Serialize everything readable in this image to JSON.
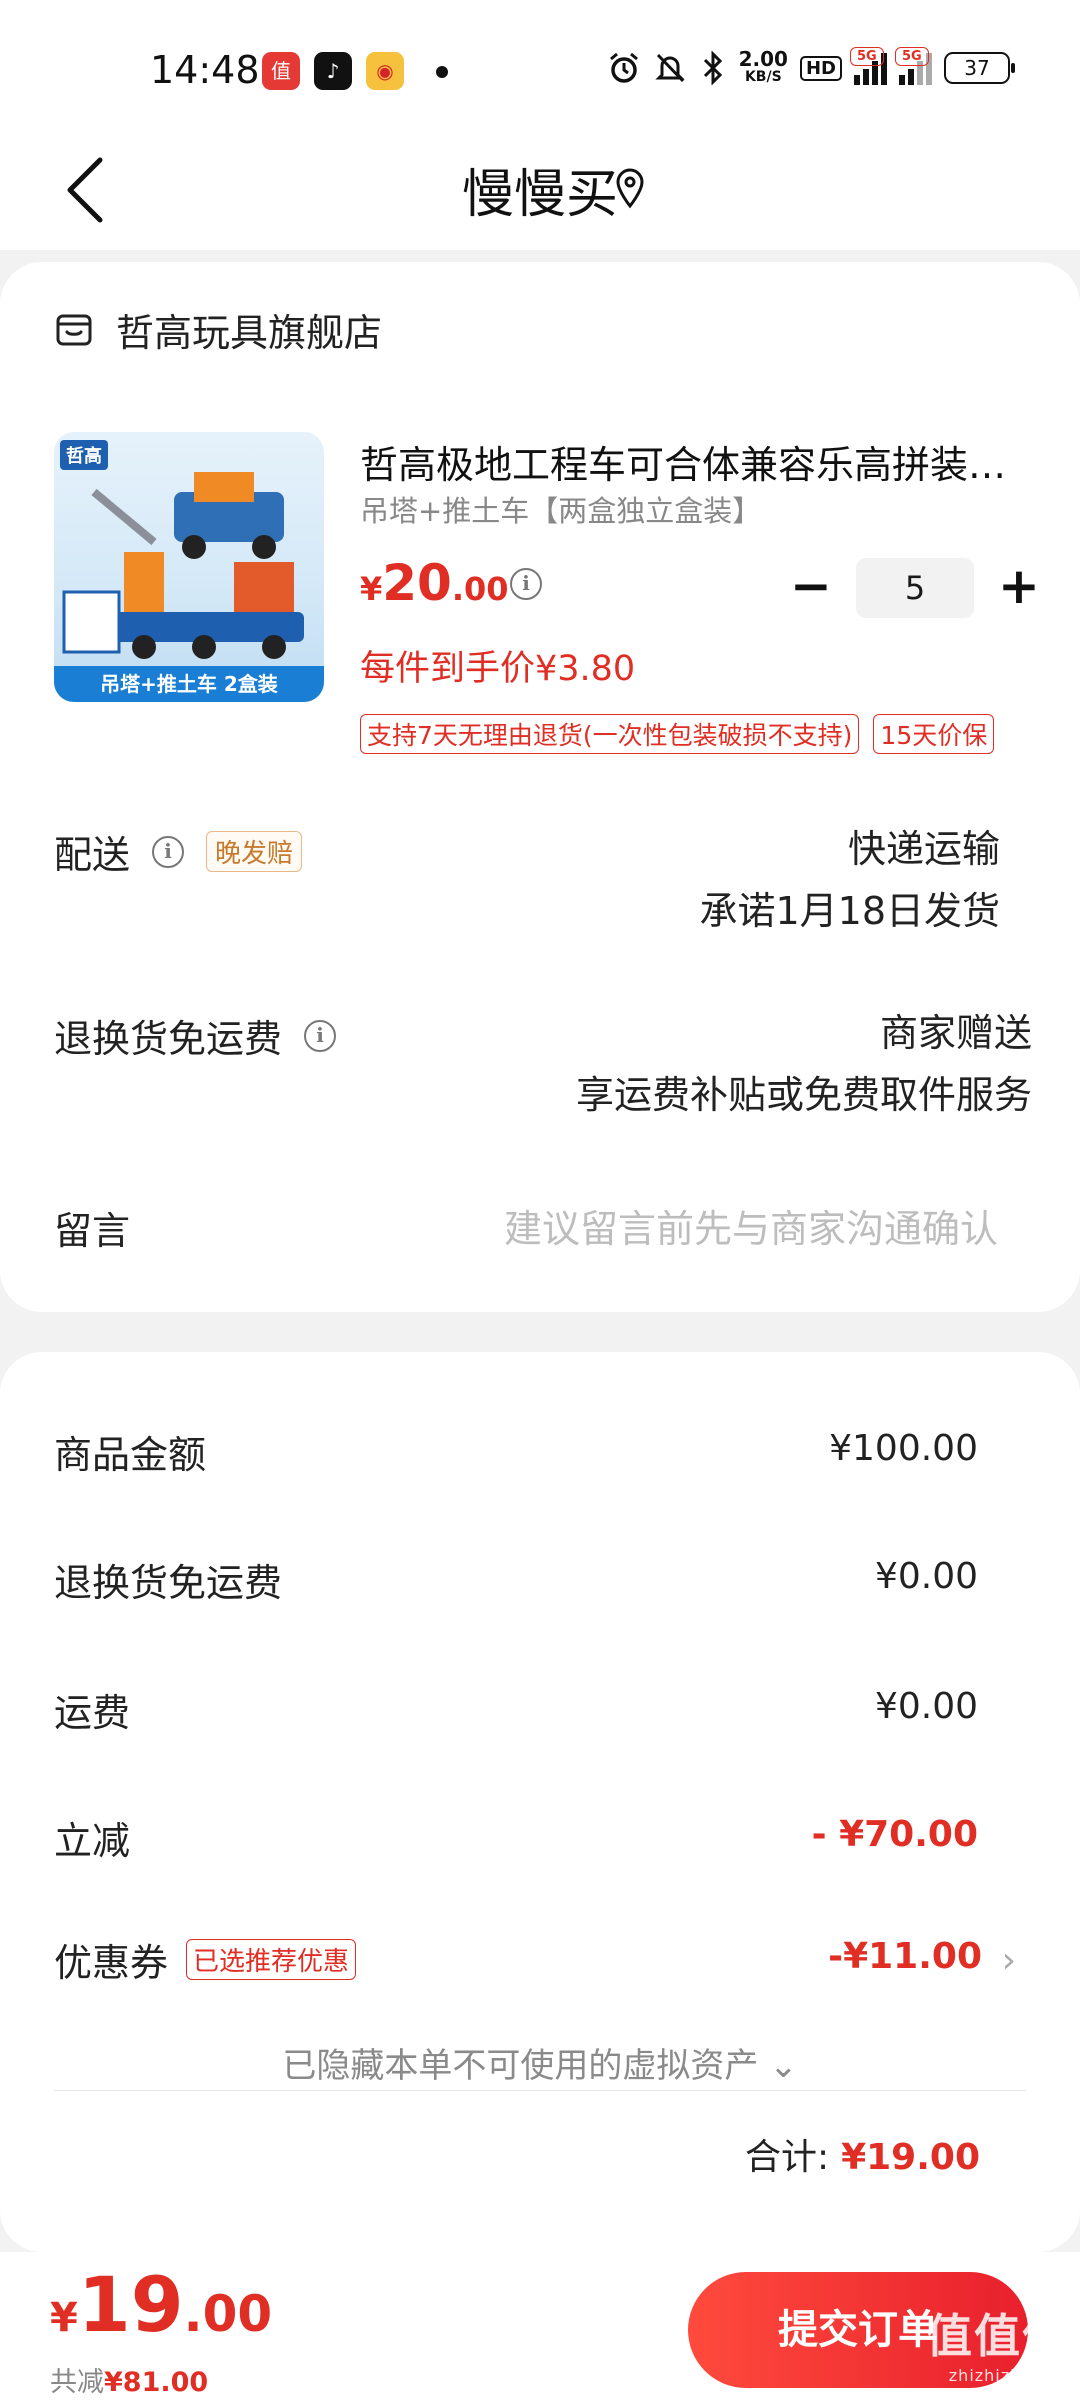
{
  "status_bar": {
    "time": "14:48",
    "net_speed": "2.00",
    "net_unit": "KB/S",
    "hd": "HD",
    "signal_1": "5G",
    "signal_2": "5G",
    "battery": "37",
    "icons": [
      "smzdm-app-icon",
      "tiktok-app-icon",
      "weibo-app-icon",
      "alarm-icon",
      "mute-icon",
      "bluetooth-icon"
    ]
  },
  "header": {
    "title": "慢慢买"
  },
  "store": {
    "name": "哲高玩具旗舰店"
  },
  "product": {
    "image_brand": "哲高",
    "image_caption": "吊塔+推土车 2盒装",
    "title": "哲高极地工程车可合体兼容乐高拼装积木",
    "spec": "吊塔+推土车【两盒独立盒装】",
    "price_currency": "¥",
    "price_int": "20",
    "price_dec": ".00",
    "quantity": "5",
    "minus": "−",
    "plus": "+",
    "unit_price": "每件到手价¥3.80",
    "tags": [
      "支持7天无理由退货(一次性包装破损不支持)",
      "15天价保"
    ]
  },
  "delivery": {
    "label": "配送",
    "badge": "晚发赔",
    "method": "快递运输",
    "promise": "承诺1月18日发货"
  },
  "return_shipping": {
    "label": "退换货免运费",
    "value": "商家赠送",
    "desc": "享运费补贴或免费取件服务"
  },
  "message": {
    "label": "留言",
    "placeholder": "建议留言前先与商家沟通确认"
  },
  "amounts": {
    "goods_label": "商品金额",
    "goods_value": "¥100.00",
    "return_fee_label": "退换货免运费",
    "return_fee_value": "¥0.00",
    "shipping_label": "运费",
    "shipping_value": "¥0.00",
    "discount_label": "立减",
    "discount_value": "- ¥70.00",
    "coupon_label": "优惠券",
    "coupon_badge": "已选推荐优惠",
    "coupon_value": "-¥11.00",
    "hidden_assets": "已隐藏本单不可使用的虚拟资产 ⌄",
    "subtotal_label": "合计:",
    "subtotal_value": "¥19.00"
  },
  "bottom": {
    "price_currency": "¥",
    "price_int": "19",
    "price_dec": ".00",
    "saved_label": "共减",
    "saved_value": "¥81.00",
    "submit": "提交订单",
    "watermark": "值值值",
    "watermark_url": "zhizhizhi.com"
  },
  "colors": {
    "accent": "#e02e24",
    "badge_orange": "#c77a2b",
    "background": "#f2f2f2"
  }
}
